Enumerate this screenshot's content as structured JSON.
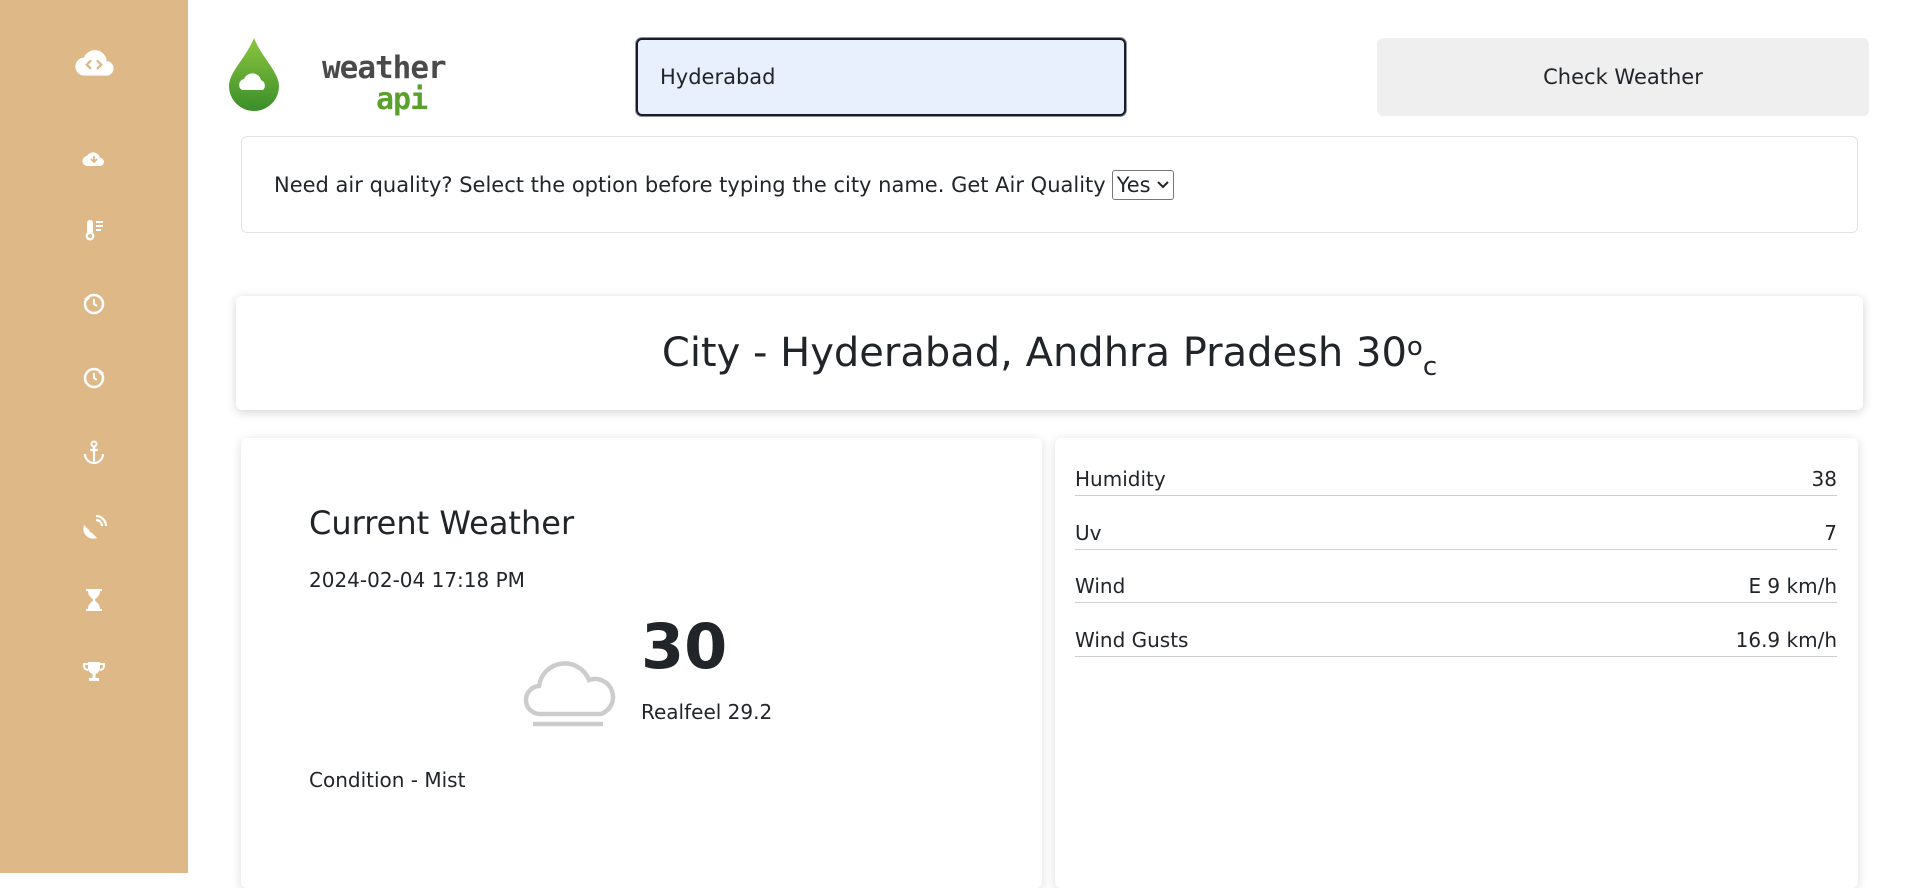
{
  "sidebar": {
    "items": [
      {
        "icon": "cloud-code-icon"
      },
      {
        "icon": "cloud-download-icon"
      },
      {
        "icon": "thermometer-icon"
      },
      {
        "icon": "history-icon"
      },
      {
        "icon": "clock-forward-icon"
      },
      {
        "icon": "anchor-icon"
      },
      {
        "icon": "satellite-dish-icon"
      },
      {
        "icon": "hourglass-icon"
      },
      {
        "icon": "trophy-icon"
      }
    ]
  },
  "header": {
    "logo_word1": "weather",
    "logo_word2": "api",
    "search_value": "Hyderabad",
    "check_button": "Check Weather"
  },
  "air_quality": {
    "prompt": "Need air quality? Select the option before typing the city name. Get Air Quality",
    "selected": "Yes"
  },
  "city": {
    "label": "City - Hyderabad, Andhra Pradesh 30",
    "deg": "o",
    "unit": "c"
  },
  "current": {
    "title": "Current Weather",
    "datetime": "2024-02-04 17:18 PM",
    "temp": "30",
    "realfeel": "Realfeel 29.2",
    "condition": "Condition - Mist"
  },
  "stats": [
    {
      "label": "Humidity",
      "value": "38"
    },
    {
      "label": "Uv",
      "value": "7"
    },
    {
      "label": "Wind",
      "value": "E 9 km/h"
    },
    {
      "label": "Wind Gusts",
      "value": "16.9 km/h"
    }
  ],
  "colors": {
    "sidebar_bg": "#deb887",
    "logo_green": "#5aa02c"
  }
}
